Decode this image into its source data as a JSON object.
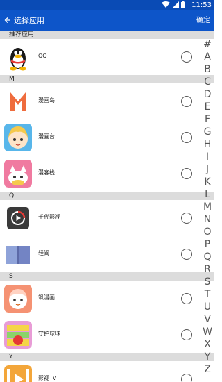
{
  "status_bar": {
    "time": "11:53"
  },
  "app_bar": {
    "title": "选择应用",
    "confirm_label": "确定"
  },
  "sections": [
    {
      "header": "推荐应用",
      "items": [
        {
          "name": "QQ",
          "icon": "qq-penguin-icon"
        }
      ]
    },
    {
      "header": "M",
      "items": [
        {
          "name": "漫画岛",
          "icon": "manhuadao-icon"
        },
        {
          "name": "漫画台",
          "icon": "manhuatai-icon"
        },
        {
          "name": "漫客栈",
          "icon": "mankezhan-icon"
        }
      ]
    },
    {
      "header": "Q",
      "items": [
        {
          "name": "千代影视",
          "icon": "qiandai-play-icon"
        },
        {
          "name": "轻阅",
          "icon": "qingyue-book-icon"
        }
      ]
    },
    {
      "header": "S",
      "items": [
        {
          "name": "飒漫画",
          "icon": "samanhua-icon"
        },
        {
          "name": "守护球球",
          "icon": "shouhu-qiuqiu-icon"
        }
      ]
    },
    {
      "header": "Y",
      "items": [
        {
          "name": "影视TV",
          "icon": "yingshi-tv-icon"
        }
      ]
    }
  ],
  "index_letters": [
    "#",
    "A",
    "B",
    "C",
    "D",
    "E",
    "F",
    "G",
    "H",
    "I",
    "J",
    "K",
    "L",
    "M",
    "N",
    "O",
    "P",
    "Q",
    "R",
    "S",
    "T",
    "U",
    "V",
    "W",
    "X",
    "Y",
    "Z"
  ],
  "colors": {
    "status_bar": "#0a4bb5",
    "app_bar": "#0d55c9",
    "section_bg": "#dcdcdc"
  }
}
